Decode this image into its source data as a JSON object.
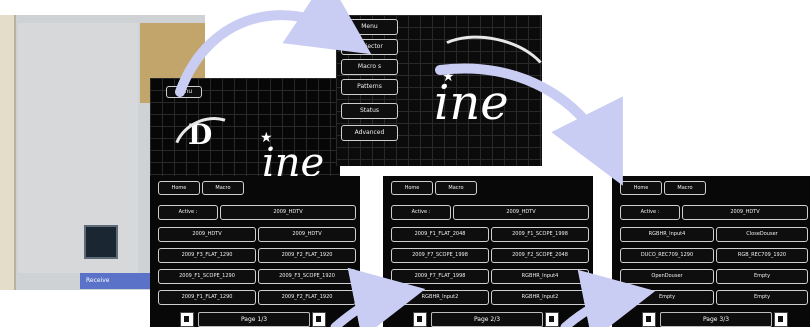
{
  "top_screen_small": {
    "button": "Menu"
  },
  "top_screen_large": {
    "menu": [
      "Menu",
      "Projector",
      "Macro s",
      "Patterns",
      "Status",
      "Advanced"
    ]
  },
  "bottom_screens": [
    {
      "header": {
        "home": "Home",
        "macro": "Macro"
      },
      "active_label": "Active :",
      "active_value": "2009_HDTV",
      "grid": [
        "2009_HDTV",
        "2009_HDTV",
        "2009_F3_FLAT_1290",
        "2009_F2_FLAT_1920",
        "2009_F1_SCOPE_1290",
        "2009_F3_SCOPE_1920",
        "2009_F1_FLAT_1290",
        "2009_F2_FLAT_1920"
      ],
      "page": "Page 1/3"
    },
    {
      "header": {
        "home": "Home",
        "macro": "Macro"
      },
      "active_label": "Active :",
      "active_value": "2009_HDTV",
      "grid": [
        "2009_F1_FLAT_2048",
        "2009_F1_SCOPE_1998",
        "2009_F7_SCOPE_1998",
        "2009_F2_SCOPE_2048",
        "2009_F7_FLAT_1998",
        "RGBHR_Input4",
        "RGBHR_Input2",
        "RGBHR_Input2"
      ],
      "page": "Page 2/3"
    },
    {
      "header": {
        "home": "Home",
        "macro": "Macro"
      },
      "active_label": "Active :",
      "active_value": "2009_HDTV",
      "grid": [
        "RGBHR_Input4",
        "CloseDouser",
        "DUCO_REC709_1290",
        "RGB_REC709_1920",
        "OpenDouser",
        "Empty",
        "Empty",
        "Empty"
      ],
      "page": "Page 3/3"
    }
  ],
  "photo": {
    "strip_text": "Receive"
  },
  "colors": {
    "arrow": "#c9cdf3",
    "screen_bg": "#0b0b0b",
    "button_border": "#cfcfcf"
  }
}
